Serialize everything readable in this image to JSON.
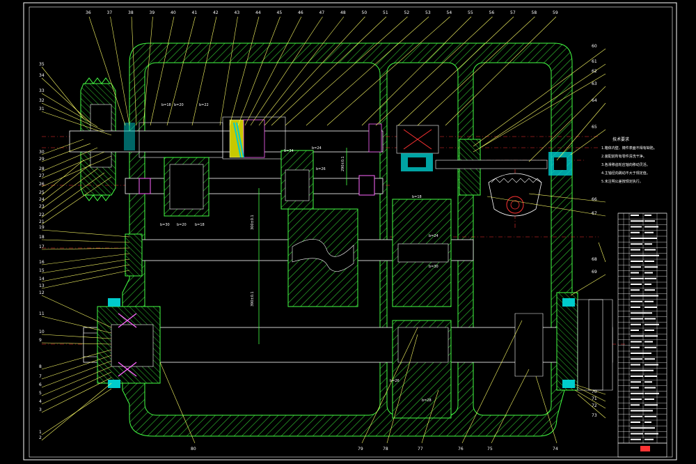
{
  "title_block": {
    "notes_heading": "技术要求",
    "notes": [
      "1.箱体内壁、铸件表面不得有缺陷。",
      "2.装配前所有零件清洗干净。",
      "3.各滑移齿轮应轴向移动灵活。",
      "4.主轴径向跳动不大于规定值。",
      "5.未注明公差按规定执行。"
    ]
  },
  "part_numbers_top": [
    "36",
    "37",
    "38",
    "39",
    "40",
    "41",
    "42",
    "43",
    "44",
    "45",
    "46",
    "47",
    "48",
    "50",
    "51",
    "52",
    "53",
    "54",
    "55",
    "56",
    "57",
    "58",
    "59"
  ],
  "part_numbers_left": [
    "35",
    "34",
    "33",
    "32",
    "31",
    "30",
    "29",
    "28",
    "27",
    "26",
    "25",
    "24",
    "23",
    "22",
    "21",
    "19",
    "18",
    "17",
    "16",
    "15",
    "14",
    "13",
    "12",
    "11",
    "10",
    "9",
    "8",
    "7",
    "6",
    "5",
    "4",
    "3",
    "2",
    "1"
  ],
  "part_numbers_right": [
    "60",
    "61",
    "62",
    "63",
    "64",
    "65",
    "66",
    "67",
    "68",
    "69",
    "70",
    "71",
    "72",
    "73"
  ],
  "part_numbers_bottom": [
    "80",
    "79",
    "78",
    "77",
    "76",
    "75",
    "74"
  ],
  "gear_tags": [
    "b=18",
    "b=20",
    "b=22",
    "b=24",
    "b=26",
    "b=30",
    "b=20",
    "b=18",
    "b=18",
    "b=24",
    "b=30",
    "b=26",
    "b=28",
    "b=34"
  ],
  "dimension_labels": [
    "300±0.1",
    "390±0.1",
    "290±0.1"
  ]
}
